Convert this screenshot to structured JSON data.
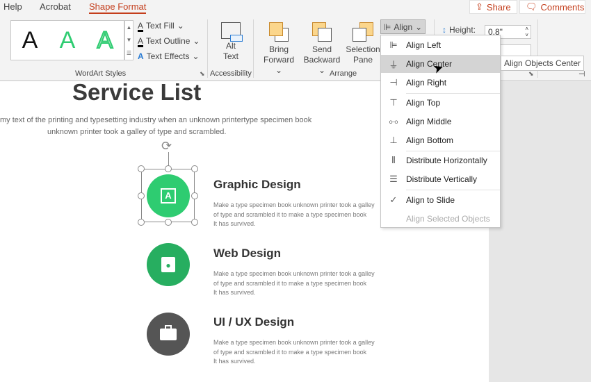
{
  "tabs": [
    "Help",
    "Acrobat",
    "Shape Format"
  ],
  "active_tab": "Shape Format",
  "share_label": "Share",
  "comments_label": "Comments",
  "wordart": {
    "group_label": "WordArt Styles",
    "samples": [
      "A",
      "A",
      "A"
    ],
    "text_fill": "Text Fill",
    "text_outline": "Text Outline",
    "text_effects": "Text Effects"
  },
  "accessibility": {
    "group_label": "Accessibility",
    "alt_text": [
      "Alt",
      "Text"
    ]
  },
  "arrange": {
    "group_label": "Arrange",
    "bring_forward": [
      "Bring",
      "Forward"
    ],
    "send_backward": [
      "Send",
      "Backward"
    ],
    "selection_pane": [
      "Selection",
      "Pane"
    ],
    "align": "Align"
  },
  "size": {
    "height_label": "Height:",
    "height_value": "0.8\""
  },
  "align_menu": {
    "items": [
      "Align Left",
      "Align Center",
      "Align Right",
      "Align Top",
      "Align Middle",
      "Align Bottom",
      "Distribute Horizontally",
      "Distribute Vertically",
      "Align to Slide",
      "Align Selected Objects"
    ],
    "highlighted": "Align Center",
    "checked": "Align to Slide",
    "disabled": "Align Selected Objects"
  },
  "tooltip": "Align Objects Center",
  "slide": {
    "title": "Service List",
    "intro": [
      "my text of the printing and typesetting industry when an unknown printertype specimen book",
      "unknown printer took a galley of type and scrambled."
    ],
    "services": [
      {
        "title": "Graphic Design",
        "lines": [
          "Make a type specimen book unknown printer took a galley",
          "of type and scrambled it to make a type specimen book",
          "It has survived."
        ],
        "color": "#2ecc71",
        "icon": "text-frame-icon"
      },
      {
        "title": "Web Design",
        "lines": [
          "Make a type specimen book unknown printer took a galley",
          "of type and scrambled it to make a type specimen book",
          "It has survived."
        ],
        "color": "#27ae60",
        "icon": "id-badge-icon"
      },
      {
        "title": "UI / UX Design",
        "lines": [
          "Make a type specimen book unknown printer took a galley",
          "of type and scrambled it to make a type specimen book",
          "It has survived."
        ],
        "color": "#555555",
        "icon": "briefcase-icon"
      }
    ]
  }
}
